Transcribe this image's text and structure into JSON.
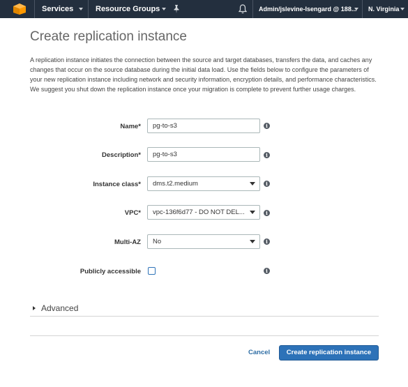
{
  "nav": {
    "services_label": "Services",
    "resource_groups_label": "Resource Groups",
    "account_label": "Admin/jslevine-Isengard @ 188...",
    "region_label": "N. Virginia"
  },
  "page": {
    "title": "Create replication instance",
    "intro": "A replication instance initiates the connection between the source and target databases, transfers the data, and caches any changes that occur on the source database during the initial data load. Use the fields below to configure the parameters of your new replication instance including network and security information, encryption details, and performance characteristics. We suggest you shut down the replication instance once your migration is complete to prevent further usage charges."
  },
  "form": {
    "name": {
      "label": "Name*",
      "value": "pg-to-s3"
    },
    "description": {
      "label": "Description*",
      "value": "pg-to-s3"
    },
    "instance_class": {
      "label": "Instance class*",
      "value": "dms.t2.medium"
    },
    "vpc": {
      "label": "VPC*",
      "value": "vpc-136f6d77 - DO NOT DEL..."
    },
    "multi_az": {
      "label": "Multi-AZ",
      "value": "No"
    },
    "publicly_accessible": {
      "label": "Publicly accessible",
      "checked": false
    }
  },
  "advanced": {
    "label": "Advanced"
  },
  "actions": {
    "cancel_label": "Cancel",
    "create_label": "Create replication instance"
  },
  "icons": {
    "logo": "aws-cube-logo",
    "pin": "pin-icon",
    "bell": "bell-icon",
    "info": "info-icon",
    "info_glyph": "i"
  },
  "colors": {
    "nav_bg": "#232f3e",
    "accent_orange": "#f90",
    "primary_button": "#2d72b8",
    "link": "#2e6da4"
  }
}
